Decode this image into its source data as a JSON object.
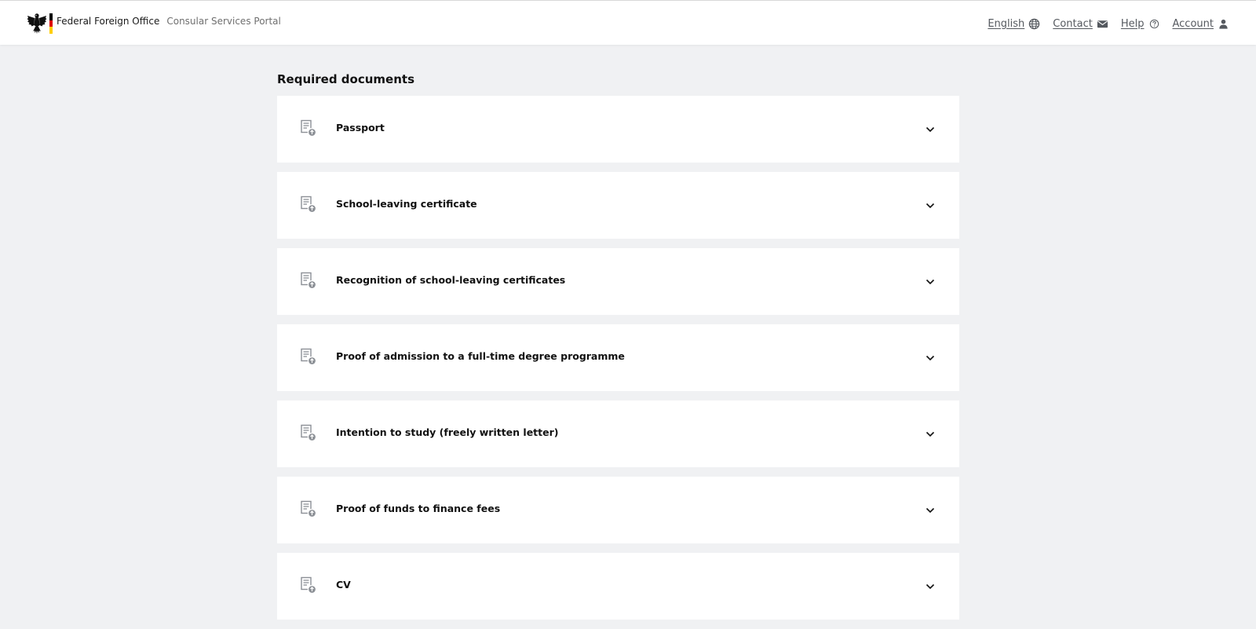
{
  "header": {
    "title": "Federal Foreign Office",
    "subtitle": "Consular Services Portal",
    "flag_colors": [
      "#000000",
      "#dd0000",
      "#ffce00"
    ],
    "nav": [
      {
        "label": "English",
        "icon": "globe-icon"
      },
      {
        "label": "Contact",
        "icon": "mail-icon"
      },
      {
        "label": "Help",
        "icon": "help-circle-icon"
      },
      {
        "label": "Account",
        "icon": "person-icon"
      }
    ]
  },
  "main": {
    "section_title": "Required documents",
    "documents": [
      {
        "label": "Passport",
        "icon": "document-upload-icon"
      },
      {
        "label": "School-leaving certificate",
        "icon": "document-upload-icon"
      },
      {
        "label": "Recognition of school-leaving certificates",
        "icon": "document-upload-icon"
      },
      {
        "label": "Proof of admission to a full-time degree programme",
        "icon": "document-upload-icon"
      },
      {
        "label": "Intention to study (freely written letter)",
        "icon": "document-upload-icon"
      },
      {
        "label": "Proof of funds to finance fees",
        "icon": "document-upload-icon"
      },
      {
        "label": "CV",
        "icon": "document-upload-icon"
      }
    ]
  },
  "colors": {
    "page_background": "#f0f1f3",
    "card_background": "#ffffff",
    "nav_text": "#55595f",
    "icon_gray": "#8c9096"
  }
}
